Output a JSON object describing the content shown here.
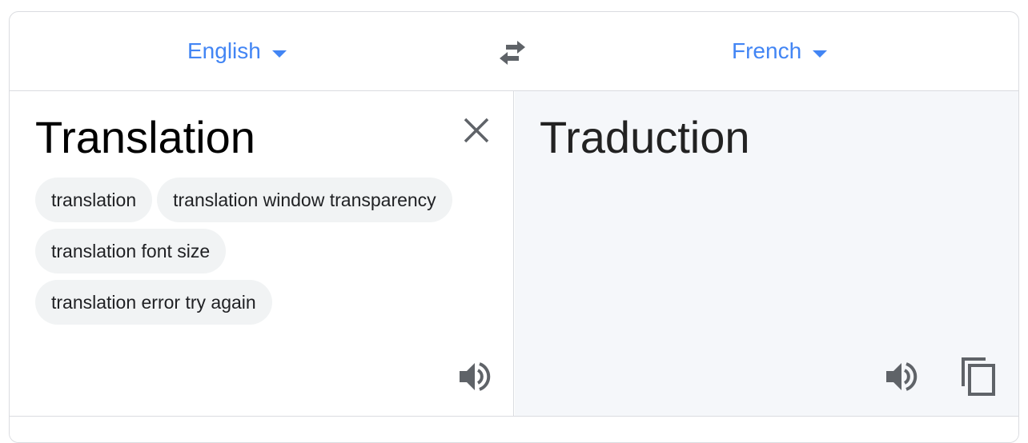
{
  "languages": {
    "source": "English",
    "target": "French"
  },
  "source": {
    "text": "Translation",
    "suggestions": [
      "translation",
      "translation window transparency",
      "translation font size",
      "translation error try again"
    ]
  },
  "target": {
    "text": "Traduction"
  },
  "icons": {
    "dropdown": "chevron-down-icon",
    "swap": "swap-arrows-icon",
    "clear": "close-icon",
    "listen": "speaker-icon",
    "copy": "copy-icon"
  },
  "colors": {
    "accent": "#4285f4",
    "icon": "#5f6368",
    "chip_bg": "#f1f3f4",
    "target_bg": "#f5f7fa",
    "border": "#dadce0"
  }
}
